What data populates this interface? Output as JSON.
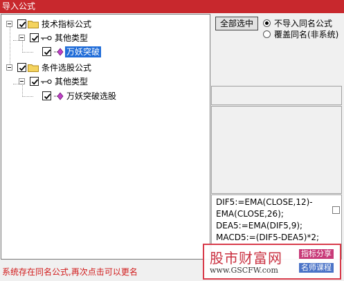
{
  "window": {
    "title": "导入公式"
  },
  "tree": {
    "groups": [
      {
        "label": "技术指标公式",
        "checked": true,
        "subgroup": {
          "label": "其他类型",
          "checked": true,
          "item": {
            "label": "万妖突破",
            "checked": true,
            "selected": true
          }
        }
      },
      {
        "label": "条件选股公式",
        "checked": true,
        "subgroup": {
          "label": "其他类型",
          "checked": true,
          "item": {
            "label": "万妖突破选股",
            "checked": true,
            "selected": false
          }
        }
      }
    ]
  },
  "actions": {
    "select_all_label": "全部选中",
    "radio_options": [
      {
        "label": "不导入同名公式",
        "selected": true
      },
      {
        "label": "覆盖同名(非系统)",
        "selected": false
      }
    ]
  },
  "code_preview": {
    "lines": [
      "DIF5:=EMA(CLOSE,12)-",
      "EMA(CLOSE,26);",
      "DEA5:=EMA(DIF5,9);",
      "MACD5:=(DIF5-DEA5)*2;"
    ]
  },
  "status": {
    "message": "系统存在同名公式,再次点击可以更名"
  },
  "watermark": {
    "title": "股市财富网",
    "url": "www.GSCFW.com",
    "tag1": "指标分享",
    "tag2": "名师课程"
  },
  "colors": {
    "titlebar": "#c8282d",
    "selection": "#1f6cd8",
    "status_text": "#d11a1a"
  }
}
